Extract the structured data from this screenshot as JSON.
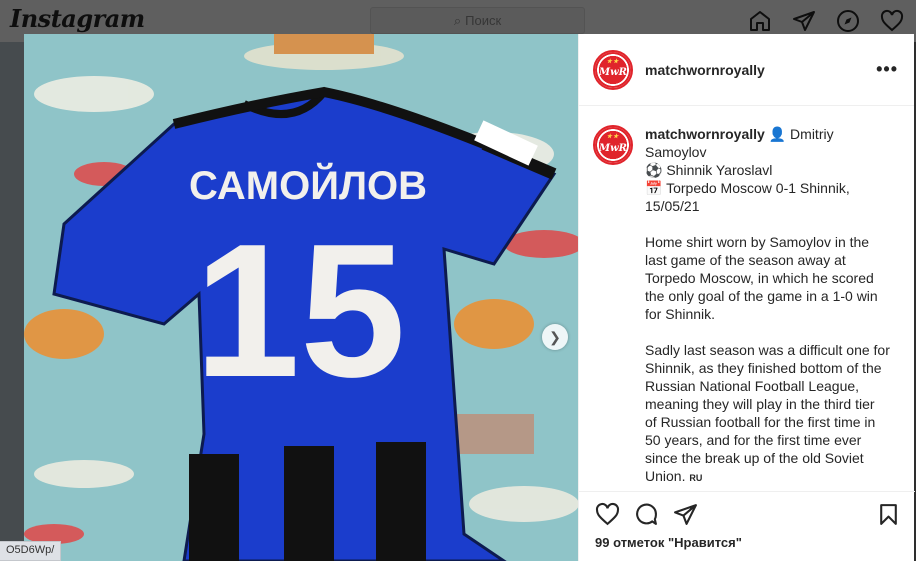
{
  "topbar": {
    "logo": "Instagram",
    "search_placeholder": "Поиск"
  },
  "post": {
    "username": "matchwornroyally",
    "avatar_text": "MwR",
    "caption": {
      "line1_emoji_text": "Dmitriy Samoylov",
      "line2": "Shinnik Yaroslavl",
      "line3": "Torpedo Moscow 0-1 Shinnik, 15/05/21",
      "para1": "Home shirt worn by Samoylov in the last game of the season away at Torpedo Moscow, in which he scored the only goal of the game in a 1-0 win for Shinnik.",
      "para2": "Sadly last season was a difficult one for Shinnik, as they finished bottom of the Russian National Football League, meaning they will play in the third tier of Russian football for the first time in 50 years, and for the first time ever since the break up of the old Soviet Union.",
      "lang_tag": "RU"
    },
    "likes_text": "99 отметок \"Нравится\"",
    "photo": {
      "shirt_name": "САМОЙЛОВ",
      "shirt_number": "15"
    }
  },
  "status_url": "O5D6Wp/",
  "icons": [
    "search-icon",
    "home-icon",
    "direct-icon",
    "explore-icon",
    "heart-icon",
    "more-icon",
    "like-icon",
    "comment-icon",
    "share-icon",
    "save-icon",
    "next-icon"
  ],
  "colors": {
    "brand_red": "#e0242b",
    "shirt_blue": "#1a3fd0"
  }
}
